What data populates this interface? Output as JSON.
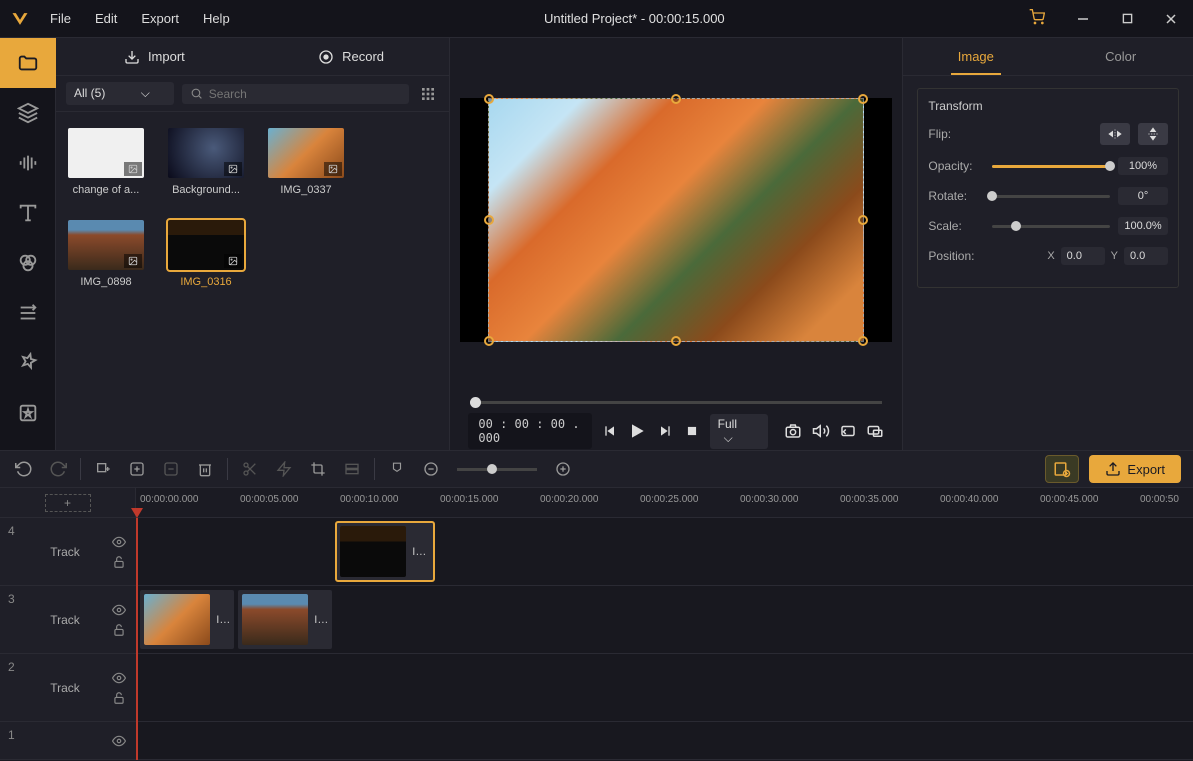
{
  "title": "Untitled Project* - 00:00:15.000",
  "menu": {
    "file": "File",
    "edit": "Edit",
    "export": "Export",
    "help": "Help"
  },
  "media": {
    "import_label": "Import",
    "record_label": "Record",
    "filter_label": "All (5)",
    "search_placeholder": "Search",
    "items": [
      {
        "label": "change of a..."
      },
      {
        "label": "Background..."
      },
      {
        "label": "IMG_0337"
      },
      {
        "label": "IMG_0898"
      },
      {
        "label": "IMG_0316"
      }
    ]
  },
  "preview": {
    "timecode": "00 : 00 : 00 . 000",
    "zoom_label": "Full"
  },
  "props": {
    "tab_image": "Image",
    "tab_color": "Color",
    "section_transform": "Transform",
    "flip_label": "Flip:",
    "opacity_label": "Opacity:",
    "opacity_value": "100%",
    "rotate_label": "Rotate:",
    "rotate_value": "0°",
    "scale_label": "Scale:",
    "scale_value": "100.0%",
    "position_label": "Position:",
    "pos_x_label": "X",
    "pos_x_value": "0.0",
    "pos_y_label": "Y",
    "pos_y_value": "0.0"
  },
  "timeline_toolbar": {
    "export_label": "Export"
  },
  "timeline": {
    "ticks": [
      "00:00:00.000",
      "00:00:05.000",
      "00:00:10.000",
      "00:00:15.000",
      "00:00:20.000",
      "00:00:25.000",
      "00:00:30.000",
      "00:00:35.000",
      "00:00:40.000",
      "00:00:45.000",
      "00:00:50"
    ],
    "tracks": [
      {
        "num": "4",
        "name": "Track"
      },
      {
        "num": "3",
        "name": "Track"
      },
      {
        "num": "2",
        "name": "Track"
      },
      {
        "num": "1",
        "name": ""
      }
    ],
    "clips": {
      "t4_c1": "IM...",
      "t3_c1": "IM...",
      "t3_c2": "IM..."
    }
  }
}
